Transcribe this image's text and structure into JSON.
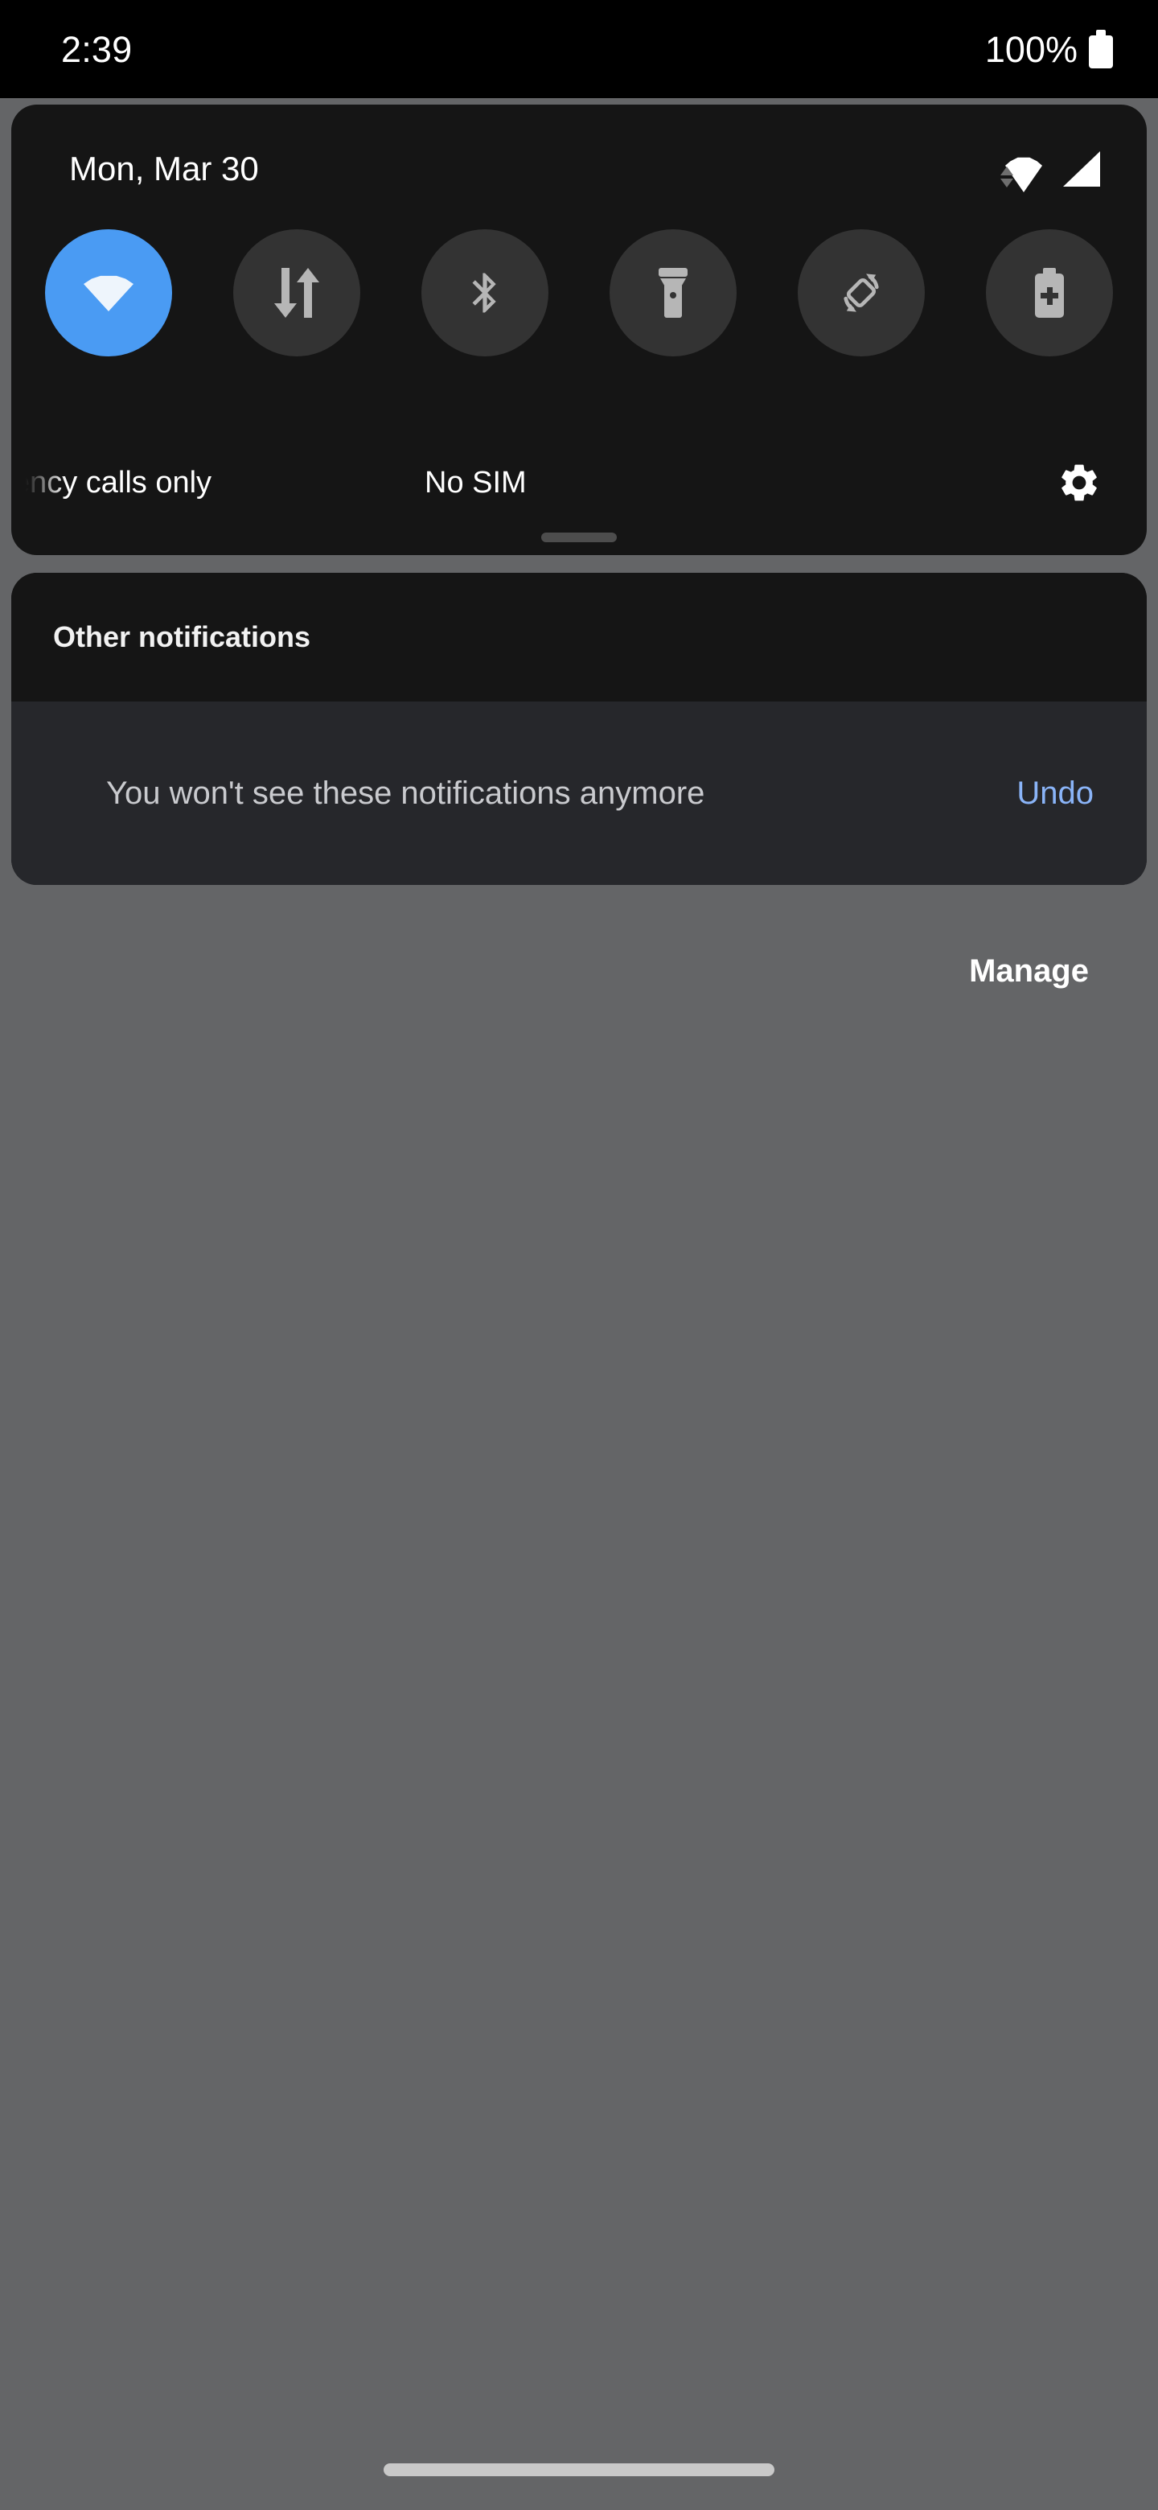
{
  "status_bar": {
    "clock": "2:39",
    "battery_percent": "100%",
    "battery_icon": "battery-full-icon"
  },
  "quick_settings": {
    "date": "Mon, Mar 30",
    "status_icons": [
      {
        "name": "wifi-icon",
        "label": "Wi-Fi connected"
      },
      {
        "name": "signal-icon",
        "label": "Mobile signal"
      }
    ],
    "tiles": [
      {
        "name": "wifi-tile",
        "icon": "wifi-icon",
        "active": true
      },
      {
        "name": "mobile-data-tile",
        "icon": "data-transfer-icon",
        "active": false
      },
      {
        "name": "bluetooth-tile",
        "icon": "bluetooth-icon",
        "active": false
      },
      {
        "name": "flashlight-tile",
        "icon": "flashlight-icon",
        "active": false
      },
      {
        "name": "auto-rotate-tile",
        "icon": "screen-rotation-icon",
        "active": false
      },
      {
        "name": "battery-saver-tile",
        "icon": "battery-plus-icon",
        "active": false
      }
    ],
    "carrier_left": "Emergency calls only",
    "carrier_right": "No SIM",
    "settings_icon": "gear-icon"
  },
  "notifications": {
    "section_title": "Other notifications",
    "undo_message": "You won't see these notifications anymore",
    "undo_label": "Undo",
    "manage_label": "Manage"
  },
  "colors": {
    "accent_blue": "#4a9bf3",
    "link_blue": "#8ab4f8",
    "panel_bg": "#151515",
    "undo_row_bg": "#26272b",
    "scrim": "#646567",
    "tile_inactive": "#333333"
  }
}
